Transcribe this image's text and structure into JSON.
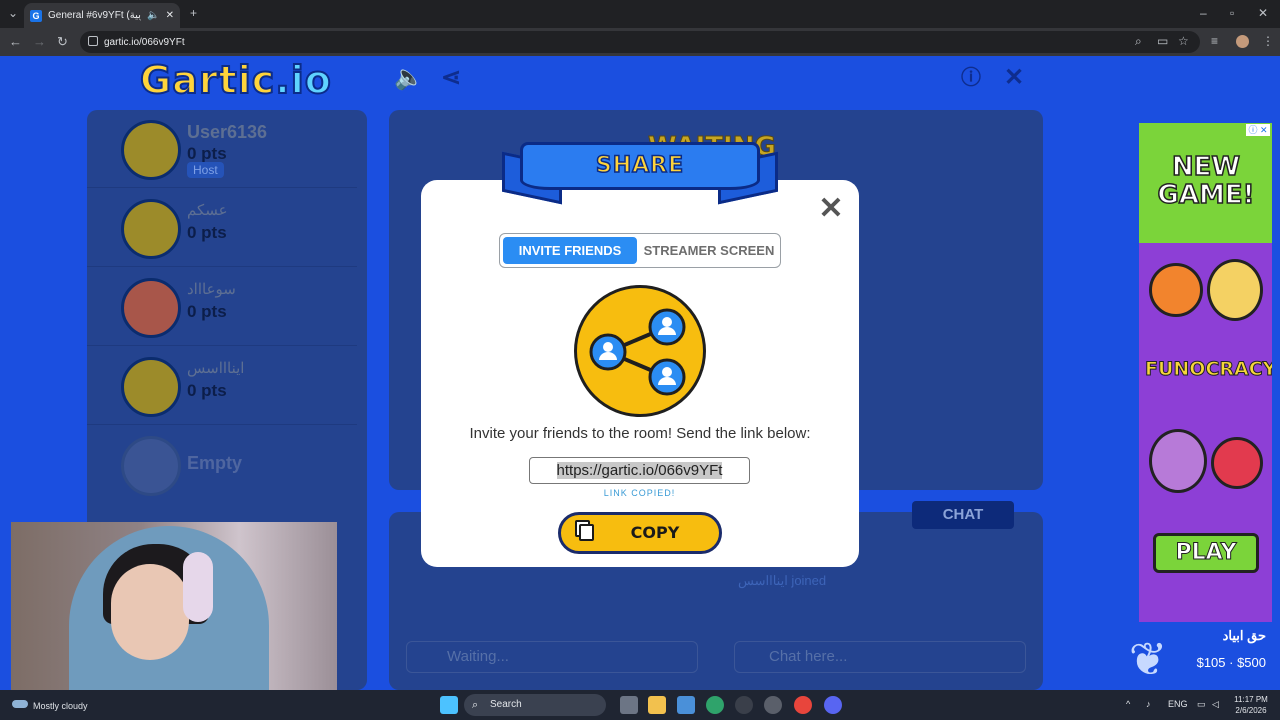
{
  "browser": {
    "tab_title": "General #6v9YFt (العربية) - G",
    "url": "gartic.io/066v9YFt"
  },
  "game": {
    "logo_main": "Gartic",
    "logo_suffix": ".io",
    "behind_title": "WAITING",
    "players": [
      {
        "name": "User6136",
        "points": "0 pts",
        "badge": "Host"
      },
      {
        "name": "عسكم",
        "points": "0 pts"
      },
      {
        "name": "سوعاااد",
        "points": "0 pts"
      },
      {
        "name": "ايناااسس",
        "points": "0 pts"
      },
      {
        "name": "Empty"
      }
    ],
    "chat_tab": "CHAT",
    "waiting_placeholder": "Waiting...",
    "chat_placeholder": "Chat here...",
    "joined_text": "ايناااسس joined"
  },
  "modal": {
    "title": "SHARE",
    "tabs": [
      "INVITE FRIENDS",
      "STREAMER SCREEN"
    ],
    "invite_text": "Invite your friends to the room! Send the link below:",
    "link": "https://gartic.io/066v9YFt",
    "copied_text": "LINK COPIED!",
    "copy_label": "COPY",
    "close": "✕"
  },
  "ad": {
    "headline": "NEW GAME!",
    "brand": "FUNOCRACY",
    "cta": "PLAY"
  },
  "overlay": {
    "donation_title": "حق ابياد",
    "donation_range": "$105 · $500"
  },
  "taskbar": {
    "weather": "Mostly cloudy",
    "search": "Search",
    "lang": "ENG",
    "time": "11:17 PM",
    "date": "2/6/2026"
  }
}
